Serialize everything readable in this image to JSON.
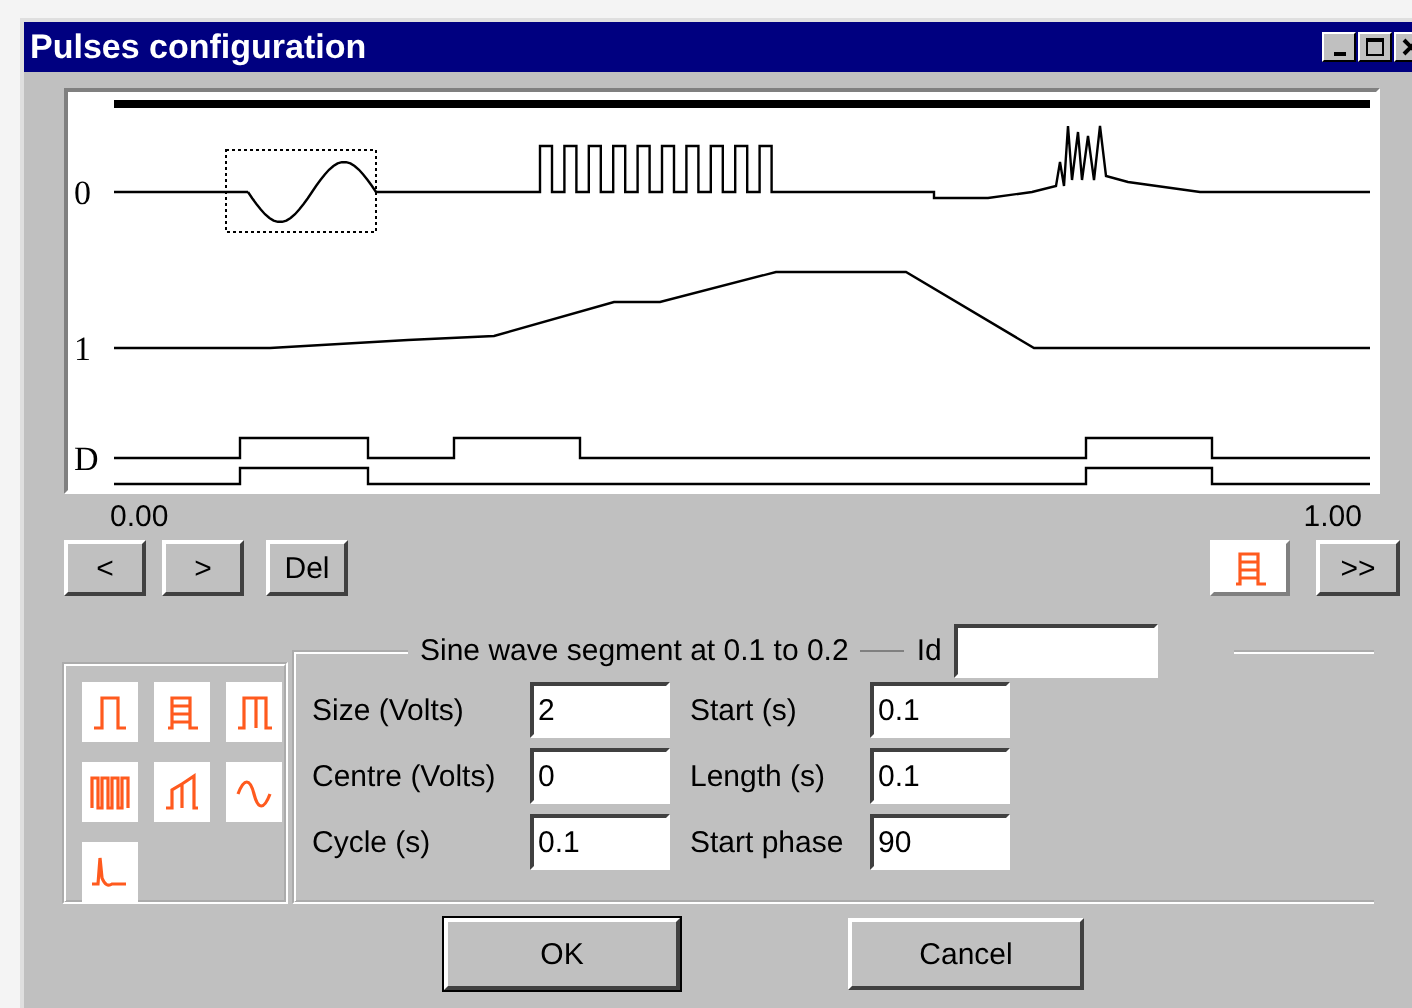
{
  "window": {
    "title": "Pulses configuration"
  },
  "plot": {
    "channels": [
      {
        "label": "0"
      },
      {
        "label": "1"
      },
      {
        "label": "D"
      }
    ],
    "x_start": "0.00",
    "x_end": "1.00"
  },
  "nav_buttons": [
    "<",
    ">",
    "Del"
  ],
  "toggle": {
    "kind": "ladder",
    "on": true
  },
  "forward_button": ">>",
  "palette": [
    {
      "kind": "pulse"
    },
    {
      "kind": "ladder"
    },
    {
      "kind": "double"
    },
    {
      "kind": "train"
    },
    {
      "kind": "ramp"
    },
    {
      "kind": "sine"
    },
    {
      "kind": "spike"
    }
  ],
  "segment": {
    "title": "Sine wave segment at 0.1 to 0.2",
    "id_label": "Id"
  },
  "fields": [
    {
      "label": "Size (Volts)",
      "value": "2"
    },
    {
      "label": "Start (s)",
      "value": "0.1"
    },
    {
      "label": "Centre (Volts)",
      "value": "0"
    },
    {
      "label": "Length (s)",
      "value": "0.1"
    },
    {
      "label": "Cycle (s)",
      "value": "0.1"
    },
    {
      "label": "Start phase",
      "value": "90"
    }
  ],
  "buttons": [
    "OK",
    "Cancel"
  ]
}
